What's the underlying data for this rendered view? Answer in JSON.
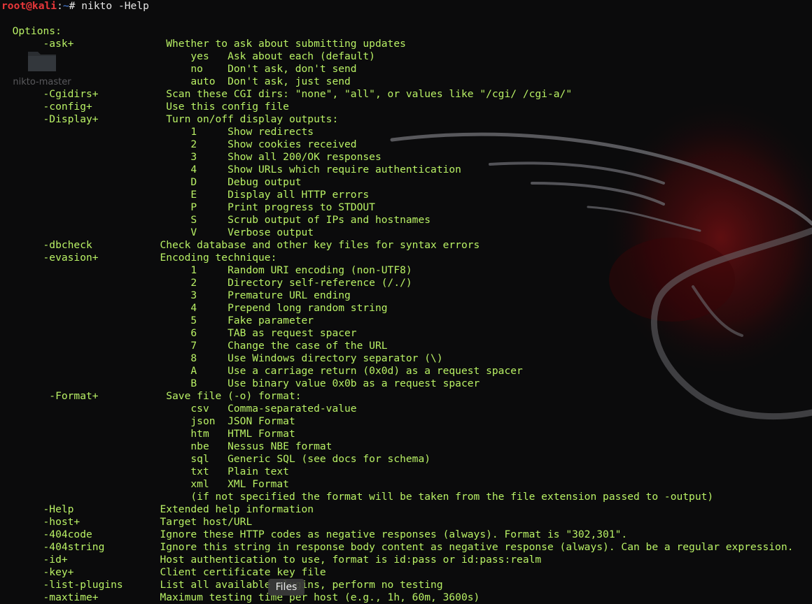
{
  "prompt": {
    "user_host": "root@kali",
    "separator": ":",
    "path": "~",
    "symbol": "# ",
    "command": "nikto -Help"
  },
  "desktop": {
    "folder_label": "nikto-master"
  },
  "dock": {
    "tooltip": "Files"
  },
  "terminal": {
    "lines": [
      {
        "text": "  Options:"
      },
      {
        "text": "       -ask+               Whether to ask about submitting updates"
      },
      {
        "text": "                               yes   Ask about each (default)"
      },
      {
        "text": "                               no    Don't ask, don't send"
      },
      {
        "text": "                               auto  Don't ask, just send"
      },
      {
        "text": "       -Cgidirs+           Scan these CGI dirs: \"none\", \"all\", or values like \"/cgi/ /cgi-a/\""
      },
      {
        "text": "       -config+            Use this config file"
      },
      {
        "text": "       -Display+           Turn on/off display outputs:"
      },
      {
        "text": "                               1     Show redirects"
      },
      {
        "text": "                               2     Show cookies received"
      },
      {
        "text": "                               3     Show all 200/OK responses"
      },
      {
        "text": "                               4     Show URLs which require authentication"
      },
      {
        "text": "                               D     Debug output"
      },
      {
        "text": "                               E     Display all HTTP errors"
      },
      {
        "text": "                               P     Print progress to STDOUT"
      },
      {
        "text": "                               S     Scrub output of IPs and hostnames"
      },
      {
        "text": "                               V     Verbose output"
      },
      {
        "text": "       -dbcheck           Check database and other key files for syntax errors"
      },
      {
        "text": "       -evasion+          Encoding technique:"
      },
      {
        "text": "                               1     Random URI encoding (non-UTF8)"
      },
      {
        "text": "                               2     Directory self-reference (/./)"
      },
      {
        "text": "                               3     Premature URL ending"
      },
      {
        "text": "                               4     Prepend long random string"
      },
      {
        "text": "                               5     Fake parameter"
      },
      {
        "text": "                               6     TAB as request spacer"
      },
      {
        "text": "                               7     Change the case of the URL"
      },
      {
        "text": "                               8     Use Windows directory separator (\\)"
      },
      {
        "text": "                               A     Use a carriage return (0x0d) as a request spacer"
      },
      {
        "text": "                               B     Use binary value 0x0b as a request spacer"
      },
      {
        "text": "        -Format+           Save file (-o) format:"
      },
      {
        "text": "                               csv   Comma-separated-value"
      },
      {
        "text": "                               json  JSON Format"
      },
      {
        "text": "                               htm   HTML Format"
      },
      {
        "text": "                               nbe   Nessus NBE format"
      },
      {
        "text": "                               sql   Generic SQL (see docs for schema)"
      },
      {
        "text": "                               txt   Plain text"
      },
      {
        "text": "                               xml   XML Format"
      },
      {
        "text": "                               (if not specified the format will be taken from the file extension passed to -output)"
      },
      {
        "text": "       -Help              Extended help information"
      },
      {
        "text": "       -host+             Target host/URL"
      },
      {
        "text": "       -404code           Ignore these HTTP codes as negative responses (always). Format is \"302,301\"."
      },
      {
        "text": "       -404string         Ignore this string in response body content as negative response (always). Can be a regular expression."
      },
      {
        "text": "       -id+               Host authentication to use, format is id:pass or id:pass:realm"
      },
      {
        "text": "       -key+              Client certificate key file"
      },
      {
        "text": "       -list-plugins      List all available plugins, perform no testing"
      },
      {
        "text": "       -maxtime+          Maximum testing time per host (e.g., 1h, 60m, 3600s)"
      }
    ]
  }
}
